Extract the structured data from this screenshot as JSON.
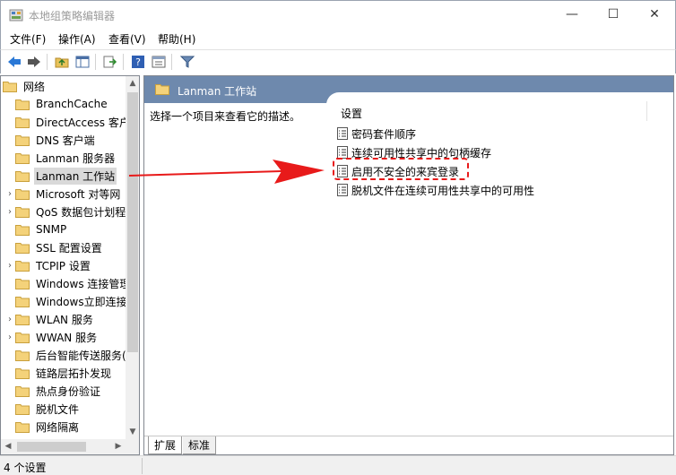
{
  "window": {
    "title": "本地组策略编辑器",
    "controls": {
      "minimize": "—",
      "maximize": "☐",
      "close": "✕"
    }
  },
  "menu": [
    "文件(F)",
    "操作(A)",
    "查看(V)",
    "帮助(H)"
  ],
  "toolbar": {
    "buttons": [
      "back-icon",
      "forward-icon",
      "up-folder-icon",
      "show-hide-tree-icon",
      "export-list-icon",
      "help-icon",
      "properties-icon",
      "filter-icon"
    ]
  },
  "tree": {
    "root": "网络",
    "items": [
      {
        "label": "BranchCache",
        "expandable": false
      },
      {
        "label": "DirectAccess 客户",
        "expandable": false
      },
      {
        "label": "DNS 客户端",
        "expandable": false
      },
      {
        "label": "Lanman 服务器",
        "expandable": false
      },
      {
        "label": "Lanman 工作站",
        "expandable": false,
        "selected": true
      },
      {
        "label": "Microsoft 对等网",
        "expandable": true
      },
      {
        "label": "QoS 数据包计划程",
        "expandable": true
      },
      {
        "label": "SNMP",
        "expandable": false
      },
      {
        "label": "SSL 配置设置",
        "expandable": false
      },
      {
        "label": "TCPIP 设置",
        "expandable": true
      },
      {
        "label": "Windows 连接管理",
        "expandable": false
      },
      {
        "label": "Windows立即连接",
        "expandable": false
      },
      {
        "label": "WLAN 服务",
        "expandable": true
      },
      {
        "label": "WWAN 服务",
        "expandable": true
      },
      {
        "label": "后台智能传送服务(",
        "expandable": false
      },
      {
        "label": "链路层拓扑发现",
        "expandable": false
      },
      {
        "label": "热点身份验证",
        "expandable": false
      },
      {
        "label": "脱机文件",
        "expandable": false
      },
      {
        "label": "网络隔离",
        "expandable": false
      }
    ]
  },
  "right_pane": {
    "header_title": "Lanman 工作站",
    "description": "选择一个项目来查看它的描述。",
    "list_header": "设置",
    "settings": [
      "密码套件顺序",
      "连续可用性共享中的句柄缓存",
      "启用不安全的来宾登录",
      "脱机文件在连续可用性共享中的可用性"
    ],
    "highlighted_index": 2,
    "tabs": [
      "扩展",
      "标准"
    ],
    "active_tab": "扩展"
  },
  "status": {
    "text": "4 个设置"
  },
  "colors": {
    "header_bg": "#6e89ad",
    "annotation_red": "#e81a1a",
    "folder_yellow": "#f4d27a"
  }
}
